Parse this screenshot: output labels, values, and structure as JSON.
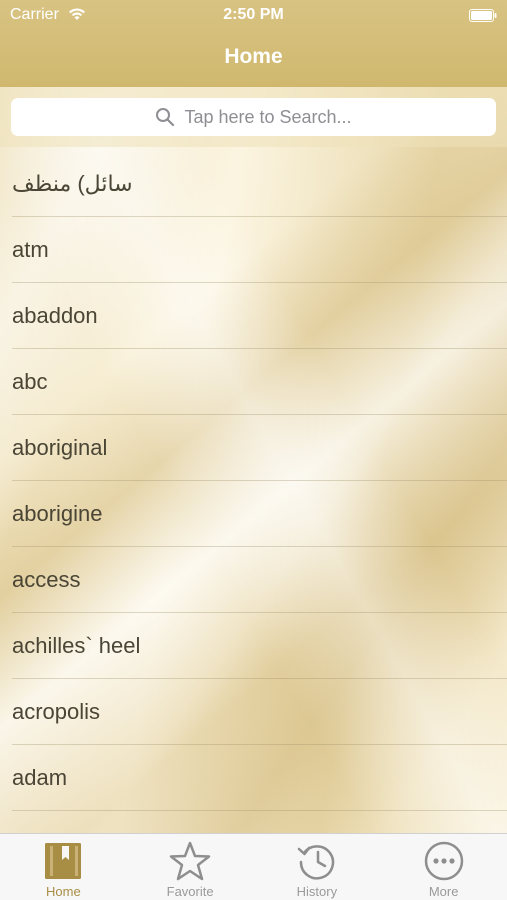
{
  "status_bar": {
    "carrier": "Carrier",
    "time": "2:50 PM"
  },
  "nav": {
    "title": "Home"
  },
  "search": {
    "placeholder": "Tap here to Search...",
    "icon": "search-icon"
  },
  "list": {
    "items": [
      {
        "label": "سائل) منظف"
      },
      {
        "label": "atm"
      },
      {
        "label": "abaddon"
      },
      {
        "label": "abc"
      },
      {
        "label": "aboriginal"
      },
      {
        "label": "aborigine"
      },
      {
        "label": "access"
      },
      {
        "label": "achilles` heel"
      },
      {
        "label": "acropolis"
      },
      {
        "label": "adam"
      },
      {
        "label": ""
      }
    ]
  },
  "tabbar": {
    "tabs": [
      {
        "label": "Home",
        "icon": "home-book-icon",
        "active": true
      },
      {
        "label": "Favorite",
        "icon": "star-icon",
        "active": false
      },
      {
        "label": "History",
        "icon": "history-clock-icon",
        "active": false
      },
      {
        "label": "More",
        "icon": "more-dots-icon",
        "active": false
      }
    ]
  },
  "colors": {
    "nav_background": "#cfb86e",
    "active_tab": "#a88d45",
    "inactive_tab": "#9a9a9a",
    "list_text": "#4a4535"
  }
}
